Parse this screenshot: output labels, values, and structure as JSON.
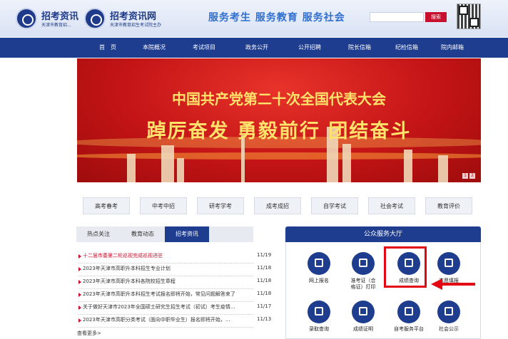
{
  "header": {
    "logo1_title": "招考资讯",
    "logo1_sub": "天津市教育招...",
    "logo2_title": "招考资讯网",
    "logo2_sub": "天津市教育招生考试院主办",
    "slogan": "服务考生  服务教育  服务社会",
    "search_button": "搜索"
  },
  "nav": {
    "items": [
      "首　页",
      "本院概况",
      "考试项目",
      "政务公开",
      "公开招聘",
      "院长信箱",
      "纪检信箱",
      "院内邮箱"
    ]
  },
  "banner": {
    "title": "中国共产党第二十次全国代表大会",
    "slogan": "踔厉奋发  勇毅前行  团结奋斗",
    "dots": [
      "1",
      "2"
    ]
  },
  "categories": [
    "高考春考",
    "中考中招",
    "研考学考",
    "成考成招",
    "自学考试",
    "社会考试",
    "教育评价"
  ],
  "news": {
    "tabs": [
      "热点关注",
      "教育动态",
      "招考资讯"
    ],
    "active_tab": 2,
    "rows": [
      {
        "title": "十二届市委第二轮巡视完成巡视进驻",
        "date": "11/19"
      },
      {
        "title": "2023年天津市高职升本科招生专业计划",
        "date": "11/18"
      },
      {
        "title": "2023年天津市高职升本科各院校招生章程",
        "date": "11/18"
      },
      {
        "title": "2023年天津市高职升本科招生考试报名即将开始，常见问题解答来了",
        "date": "11/18"
      },
      {
        "title": "关于做好天津市2023年全国硕士研究生招生考试（初试）考生疫情...",
        "date": "11/17"
      },
      {
        "title": "2023年天津市高职分类考试（面向中职毕业生）报名即将开始，...",
        "date": "11/13"
      }
    ],
    "more": "查看更多>"
  },
  "services": {
    "title": "公众服务大厅",
    "row1": [
      {
        "label": "网上报名",
        "icon": "monitor-icon"
      },
      {
        "label": "准考证（合格证）打印",
        "icon": "printer-icon"
      },
      {
        "label": "成绩查询",
        "icon": "score-report-icon"
      },
      {
        "label": "志愿填报",
        "icon": "list-form-icon"
      }
    ],
    "row2": [
      {
        "label": "录取查询",
        "icon": "graduation-cap-icon"
      },
      {
        "label": "成绩证明",
        "icon": "certificate-icon"
      },
      {
        "label": "自考服务平台",
        "icon": "laptop-icon"
      },
      {
        "label": "社会公示",
        "icon": "notice-board-icon"
      }
    ]
  },
  "colors": {
    "nav_blue": "#1e3d8f",
    "banner_red": "#c41416",
    "banner_gold": "#ffe36b",
    "highlight_red": "#e30613"
  }
}
